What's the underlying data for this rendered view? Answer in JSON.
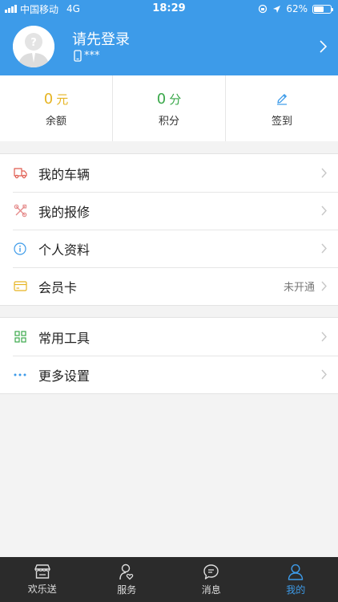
{
  "status_bar": {
    "carrier": "中国移动",
    "network": "4G",
    "time": "18:29",
    "battery": "62%",
    "battery_level": 0.62
  },
  "profile": {
    "title": "请先登录",
    "phone": "***"
  },
  "stats": [
    {
      "value": "0",
      "unit": "元",
      "label": "余额",
      "color": "#e6b422"
    },
    {
      "value": "0",
      "unit": "分",
      "label": "积分",
      "color": "#3aa84a"
    },
    {
      "label": "签到",
      "icon": "pencil-icon",
      "color": "#3d9be9"
    }
  ],
  "menu_group_1": [
    {
      "label": "我的车辆",
      "icon": "truck-icon",
      "color": "#e05a4e"
    },
    {
      "label": "我的报修",
      "icon": "tools-icon",
      "color": "#e58a8a"
    },
    {
      "label": "个人资料",
      "icon": "info-icon",
      "color": "#3d9be9"
    },
    {
      "label": "会员卡",
      "icon": "card-icon",
      "color": "#e6b422",
      "extra": "未开通"
    }
  ],
  "menu_group_2": [
    {
      "label": "常用工具",
      "icon": "grid-icon",
      "color": "#3aa84a"
    },
    {
      "label": "更多设置",
      "icon": "more-icon",
      "color": "#3d9be9"
    }
  ],
  "tabs": [
    {
      "label": "欢乐送",
      "icon": "store-icon"
    },
    {
      "label": "服务",
      "icon": "service-icon"
    },
    {
      "label": "消息",
      "icon": "message-icon"
    },
    {
      "label": "我的",
      "icon": "user-icon",
      "active": true
    }
  ]
}
